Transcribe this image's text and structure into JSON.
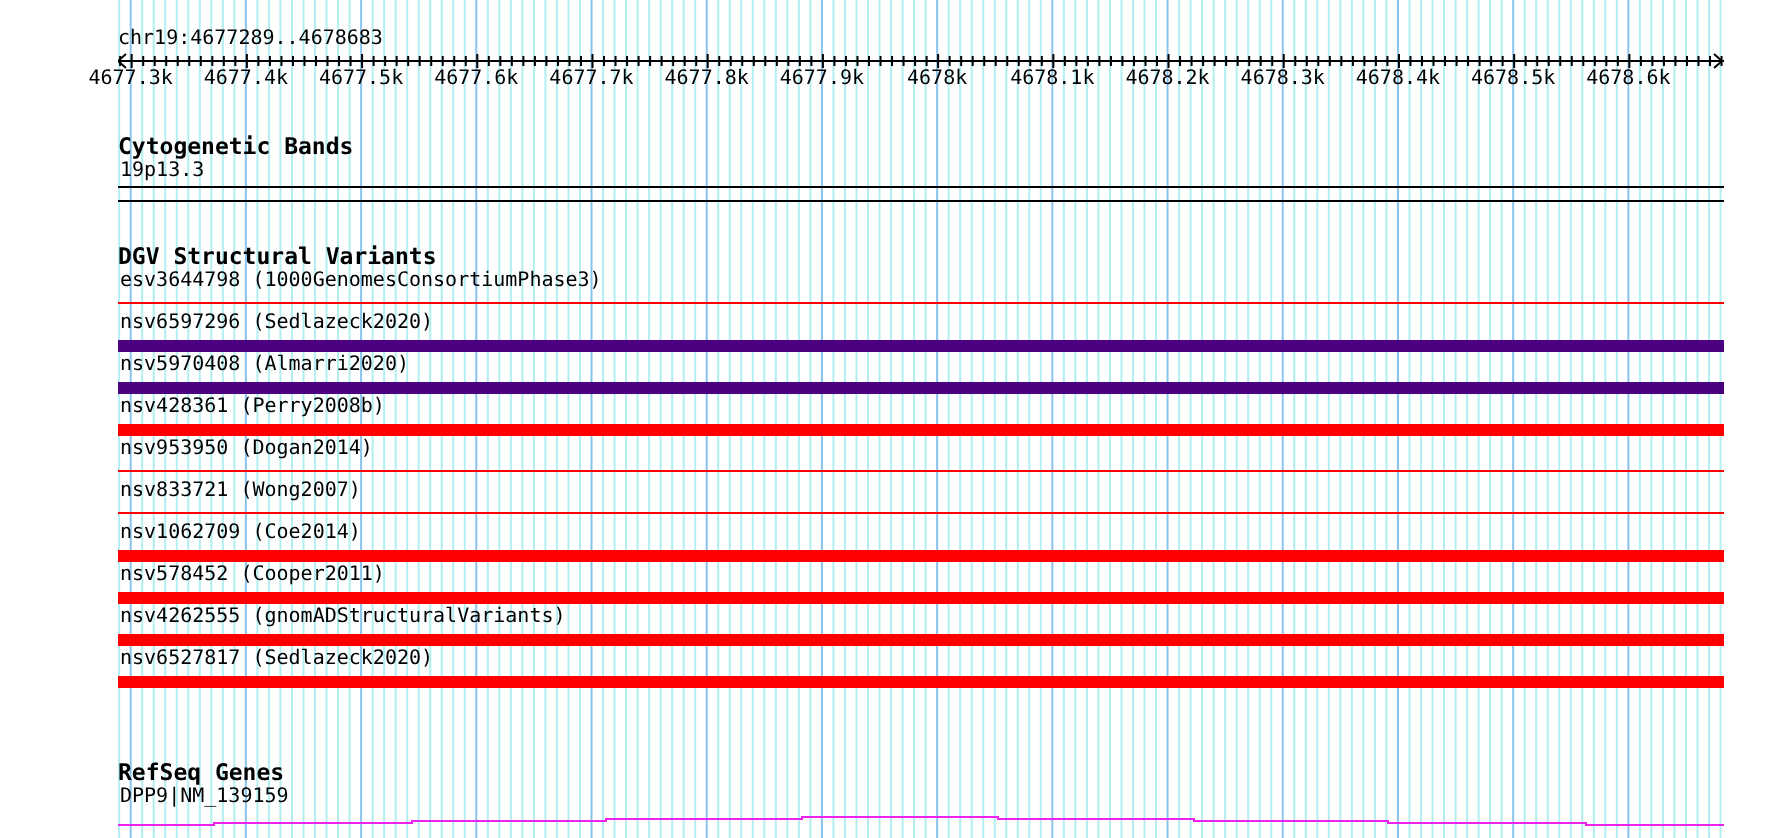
{
  "position": "chr19:4677289..4678683",
  "ruler": {
    "labels": [
      "4677.3k",
      "4677.4k",
      "4677.5k",
      "4677.6k",
      "4677.7k",
      "4677.8k",
      "4677.9k",
      "4678k",
      "4678.1k",
      "4678.2k",
      "4678.3k",
      "4678.4k",
      "4678.5k",
      "4678.6k"
    ]
  },
  "tracks": [
    {
      "kind": "bands",
      "title": "Cytogenetic Bands",
      "features": [
        {
          "label": "19p13.3"
        }
      ]
    },
    {
      "kind": "variants",
      "title": "DGV Structural Variants",
      "features": [
        {
          "label": "esv3644798 (1000GenomesConsortiumPhase3)",
          "kind": "line",
          "color": "#ff0000"
        },
        {
          "label": "nsv6597296 (Sedlazeck2020)",
          "kind": "bar",
          "color": "#4b0082"
        },
        {
          "label": "nsv5970408 (Almarri2020)",
          "kind": "bar",
          "color": "#4b0082"
        },
        {
          "label": "nsv428361 (Perry2008b)",
          "kind": "bar",
          "color": "#ff0000"
        },
        {
          "label": "nsv953950 (Dogan2014)",
          "kind": "line",
          "color": "#ff0000"
        },
        {
          "label": "nsv833721 (Wong2007)",
          "kind": "line",
          "color": "#ff0000"
        },
        {
          "label": "nsv1062709 (Coe2014)",
          "kind": "bar",
          "color": "#ff0000"
        },
        {
          "label": "nsv578452 (Cooper2011)",
          "kind": "bar",
          "color": "#ff0000"
        },
        {
          "label": "nsv4262555 (gnomADStructuralVariants)",
          "kind": "bar",
          "color": "#ff0000"
        },
        {
          "label": "nsv6527817 (Sedlazeck2020)",
          "kind": "bar",
          "color": "#ff0000"
        }
      ]
    },
    {
      "kind": "genes",
      "title": "RefSeq Genes",
      "features": [
        {
          "label": "DPP9|NM_139159"
        }
      ]
    }
  ]
}
